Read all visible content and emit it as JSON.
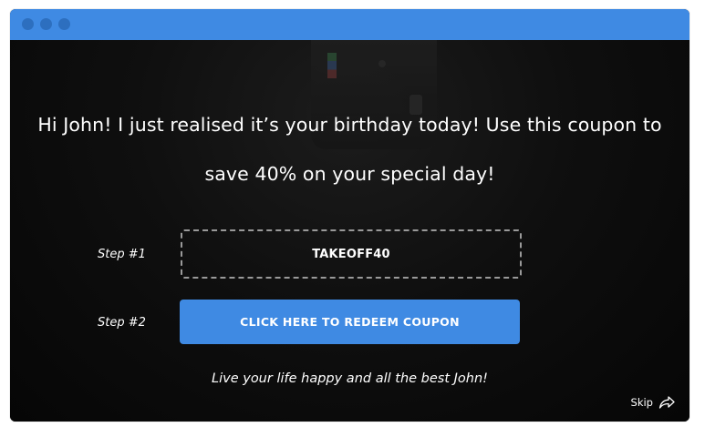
{
  "popup": {
    "headline_line1": "Hi John! I just realised it’s your birthday today! Use this coupon to",
    "headline_line2": "save 40% on your special day!",
    "step1_label": "Step #1",
    "coupon_code": "TAKEOFF40",
    "step2_label": "Step #2",
    "redeem_button_label": "CLICK HERE TO REDEEM COUPON",
    "closing_message": "Live your life happy and all the best John!",
    "skip_label": "Skip",
    "skip_icon": "share-arrow-icon"
  },
  "colors": {
    "titlebar": "#3f8ae3",
    "button": "#3f8ae3",
    "background": "#0b0b0b",
    "text": "#ffffff"
  }
}
